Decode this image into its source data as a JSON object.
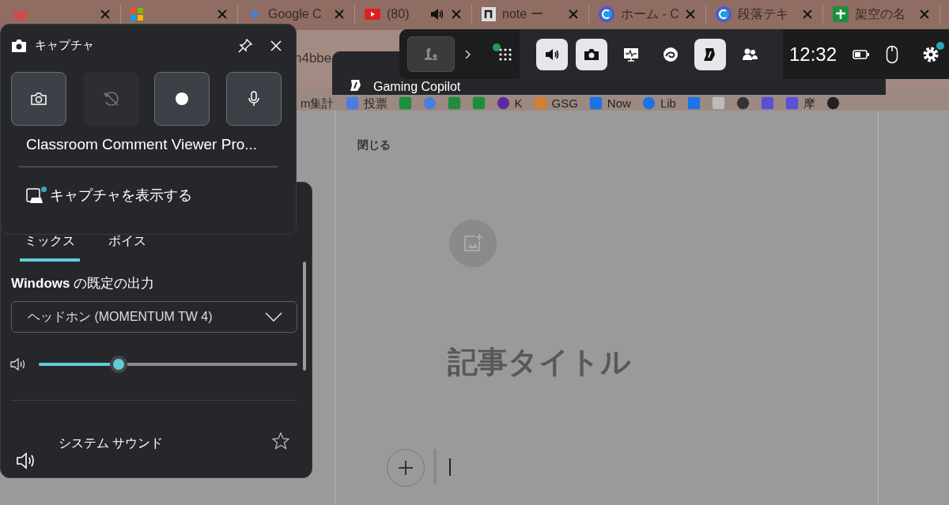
{
  "browser": {
    "tabs": [
      {
        "kind": "covered",
        "playing_audio": false
      },
      {
        "kind": "covered",
        "playing_audio": false
      },
      {
        "kind": "titled",
        "title": "Google C",
        "playing_audio": false
      },
      {
        "kind": "titled",
        "title": "(80)",
        "playing_audio": true
      },
      {
        "kind": "titled",
        "title": "note ー",
        "playing_audio": false
      },
      {
        "kind": "titled",
        "title": "ホーム - C",
        "playing_audio": false
      },
      {
        "kind": "titled",
        "title": "段落テキ",
        "playing_audio": false
      },
      {
        "kind": "titled",
        "title": "架空の名",
        "playing_audio": false
      }
    ],
    "address_fragment": "n4bbe",
    "bookmarks": [
      {
        "kind": "labeled",
        "label": "m集計"
      },
      {
        "kind": "labeled",
        "label": "投票"
      },
      {
        "kind": "icon"
      },
      {
        "kind": "icon"
      },
      {
        "kind": "icon"
      },
      {
        "kind": "icon"
      },
      {
        "kind": "labeled",
        "label": "K"
      },
      {
        "kind": "labeled",
        "label": "GSG"
      },
      {
        "kind": "labeled",
        "label": "Now"
      },
      {
        "kind": "labeled",
        "label": "Lib"
      },
      {
        "kind": "icon"
      },
      {
        "kind": "icon"
      },
      {
        "kind": "icon"
      },
      {
        "kind": "icon"
      },
      {
        "kind": "labeled",
        "label": "摩"
      },
      {
        "kind": "icon"
      }
    ]
  },
  "page": {
    "close_label": "閉じる",
    "title_placeholder": "記事タイトル"
  },
  "copilot_widget": {
    "title": "Gaming Copilot"
  },
  "game_bar": {
    "widget_menu_badge": true,
    "buttons": [
      {
        "selected": true
      },
      {
        "selected": true
      },
      {
        "selected": false
      },
      {
        "selected": false
      },
      {
        "selected": true
      },
      {
        "selected": false
      }
    ],
    "time": "12:32",
    "settings_badge": true
  },
  "capture_widget": {
    "title": "キャプチャ",
    "actions": [
      {
        "disabled": false
      },
      {
        "disabled": true
      },
      {
        "disabled": false
      },
      {
        "disabled": false
      }
    ],
    "app_name": "Classroom Comment Viewer Pro...",
    "show_captures": "キャプチャを表示する",
    "captures_badge": true
  },
  "audio_widget": {
    "tabs": [
      {
        "label": "ミックス",
        "selected": true
      },
      {
        "label": "ボイス",
        "selected": false
      }
    ],
    "output_label": "**Windows** の既定の出力",
    "device": "ヘッドホン (MOMENTUM TW 4)",
    "level": 0.31,
    "apps": [
      {
        "name": "システム サウンド",
        "favorite": false
      }
    ]
  }
}
